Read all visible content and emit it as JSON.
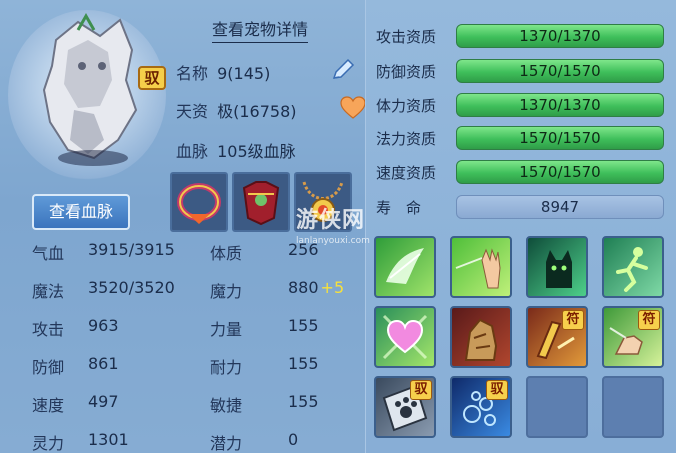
{
  "pet": {
    "detail_title": "查看宠物详情",
    "name_label": "名称",
    "name_value": "9(145)",
    "talent_label": "天资",
    "talent_value": "极(16758)",
    "bloodline_label": "血脉",
    "bloodline_value": "105级血脉",
    "mount_badge": "驭",
    "view_bloodline_button": "查看血脉"
  },
  "equipment": [
    {
      "name": "collar",
      "icon": "collar-equip-icon"
    },
    {
      "name": "armor",
      "icon": "armor-equip-icon"
    },
    {
      "name": "amulet",
      "icon": "amulet-equip-icon"
    }
  ],
  "stats": [
    {
      "l1": "气血",
      "v1": "3915/3915",
      "l2": "体质",
      "v2": "256",
      "bonus": ""
    },
    {
      "l1": "魔法",
      "v1": "3520/3520",
      "l2": "魔力",
      "v2": "880",
      "bonus": "+5"
    },
    {
      "l1": "攻击",
      "v1": "963",
      "l2": "力量",
      "v2": "155",
      "bonus": ""
    },
    {
      "l1": "防御",
      "v1": "861",
      "l2": "耐力",
      "v2": "155",
      "bonus": ""
    },
    {
      "l1": "速度",
      "v1": "497",
      "l2": "敏捷",
      "v2": "155",
      "bonus": ""
    },
    {
      "l1": "灵力",
      "v1": "1301",
      "l2": "潜力",
      "v2": "0",
      "bonus": ""
    }
  ],
  "aptitudes": [
    {
      "label": "攻击资质",
      "value": "1370/1370"
    },
    {
      "label": "防御资质",
      "value": "1570/1570"
    },
    {
      "label": "体力资质",
      "value": "1370/1370"
    },
    {
      "label": "法力资质",
      "value": "1570/1570"
    },
    {
      "label": "速度资质",
      "value": "1570/1570"
    }
  ],
  "life": {
    "label": "寿　命",
    "value": "8947"
  },
  "skills": [
    {
      "icon": "wing-skill-icon",
      "tag": ""
    },
    {
      "icon": "hand-skill-icon",
      "tag": ""
    },
    {
      "icon": "cat-skill-icon",
      "tag": ""
    },
    {
      "icon": "runner-skill-icon",
      "tag": ""
    },
    {
      "icon": "heart-skill-icon",
      "tag": ""
    },
    {
      "icon": "rock-skill-icon",
      "tag": ""
    },
    {
      "icon": "scroll-skill-icon",
      "tag": "符"
    },
    {
      "icon": "palm-skill-icon",
      "tag": "符"
    },
    {
      "icon": "paw-skill-icon",
      "tag": "驭"
    },
    {
      "icon": "bubble-skill-icon",
      "tag": "驭"
    },
    {
      "icon": "empty-slot",
      "tag": ""
    },
    {
      "icon": "empty-slot",
      "tag": ""
    }
  ],
  "watermark": {
    "text": "游侠网",
    "url": "lanlanyouxi.com"
  },
  "colors": {
    "bar_green": "#3fbf5b",
    "bonus_yellow": "#f7e13b",
    "badge_gold": "#f5cf4a"
  }
}
